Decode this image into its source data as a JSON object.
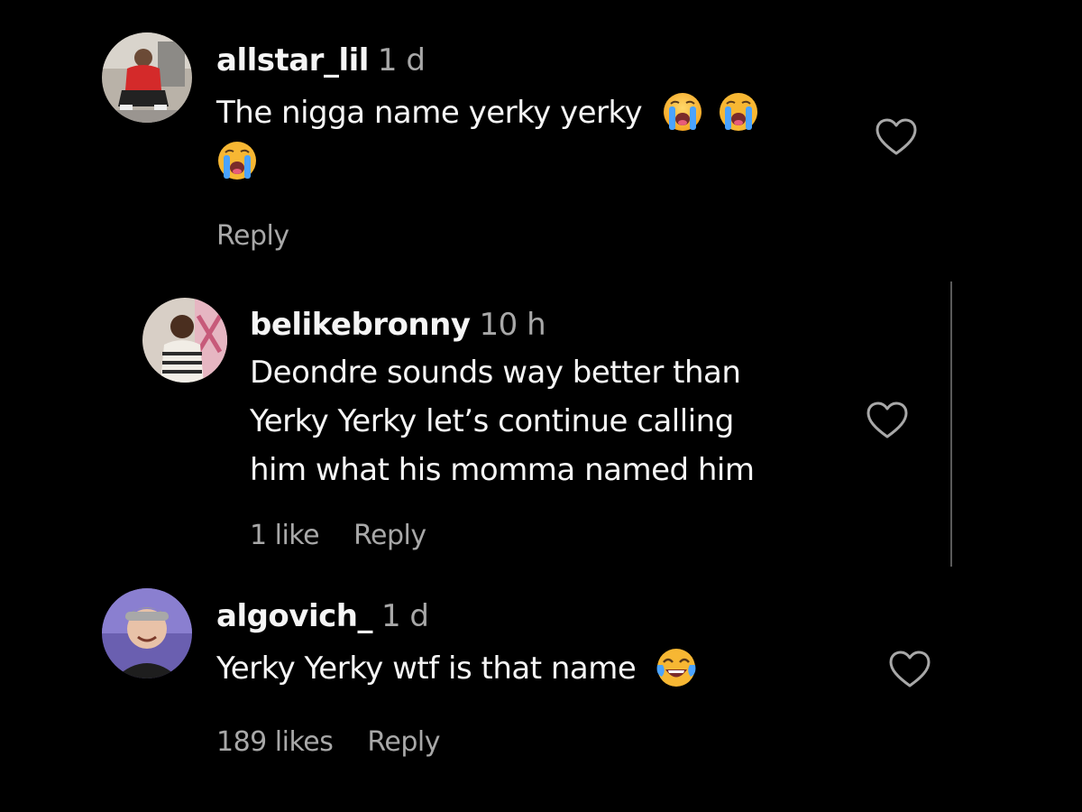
{
  "comments": [
    {
      "username": "allstar_lil",
      "time": "1 d",
      "text": "The nigga name yerky yerky",
      "emojis": [
        "loudly-crying-face-icon",
        "loudly-crying-face-icon",
        "loudly-crying-face-icon"
      ],
      "likes": "",
      "reply_label": "Reply"
    },
    {
      "username": "belikebronny",
      "time": "10 h",
      "text_lines": [
        "Deondre sounds way better than",
        "Yerky Yerky let’s continue calling",
        "him what his momma named him"
      ],
      "likes": "1 like",
      "reply_label": "Reply"
    },
    {
      "username": "algovich_",
      "time": "1 d",
      "text": "Yerky Yerky wtf is that name",
      "emojis": [
        "face-with-tears-of-joy-icon"
      ],
      "likes": "189 likes",
      "reply_label": "Reply"
    }
  ],
  "colors": {
    "background": "#000000",
    "primary_text": "#f5f5f5",
    "secondary_text": "#a8a8a8",
    "thread_line": "#5a5a5a"
  }
}
